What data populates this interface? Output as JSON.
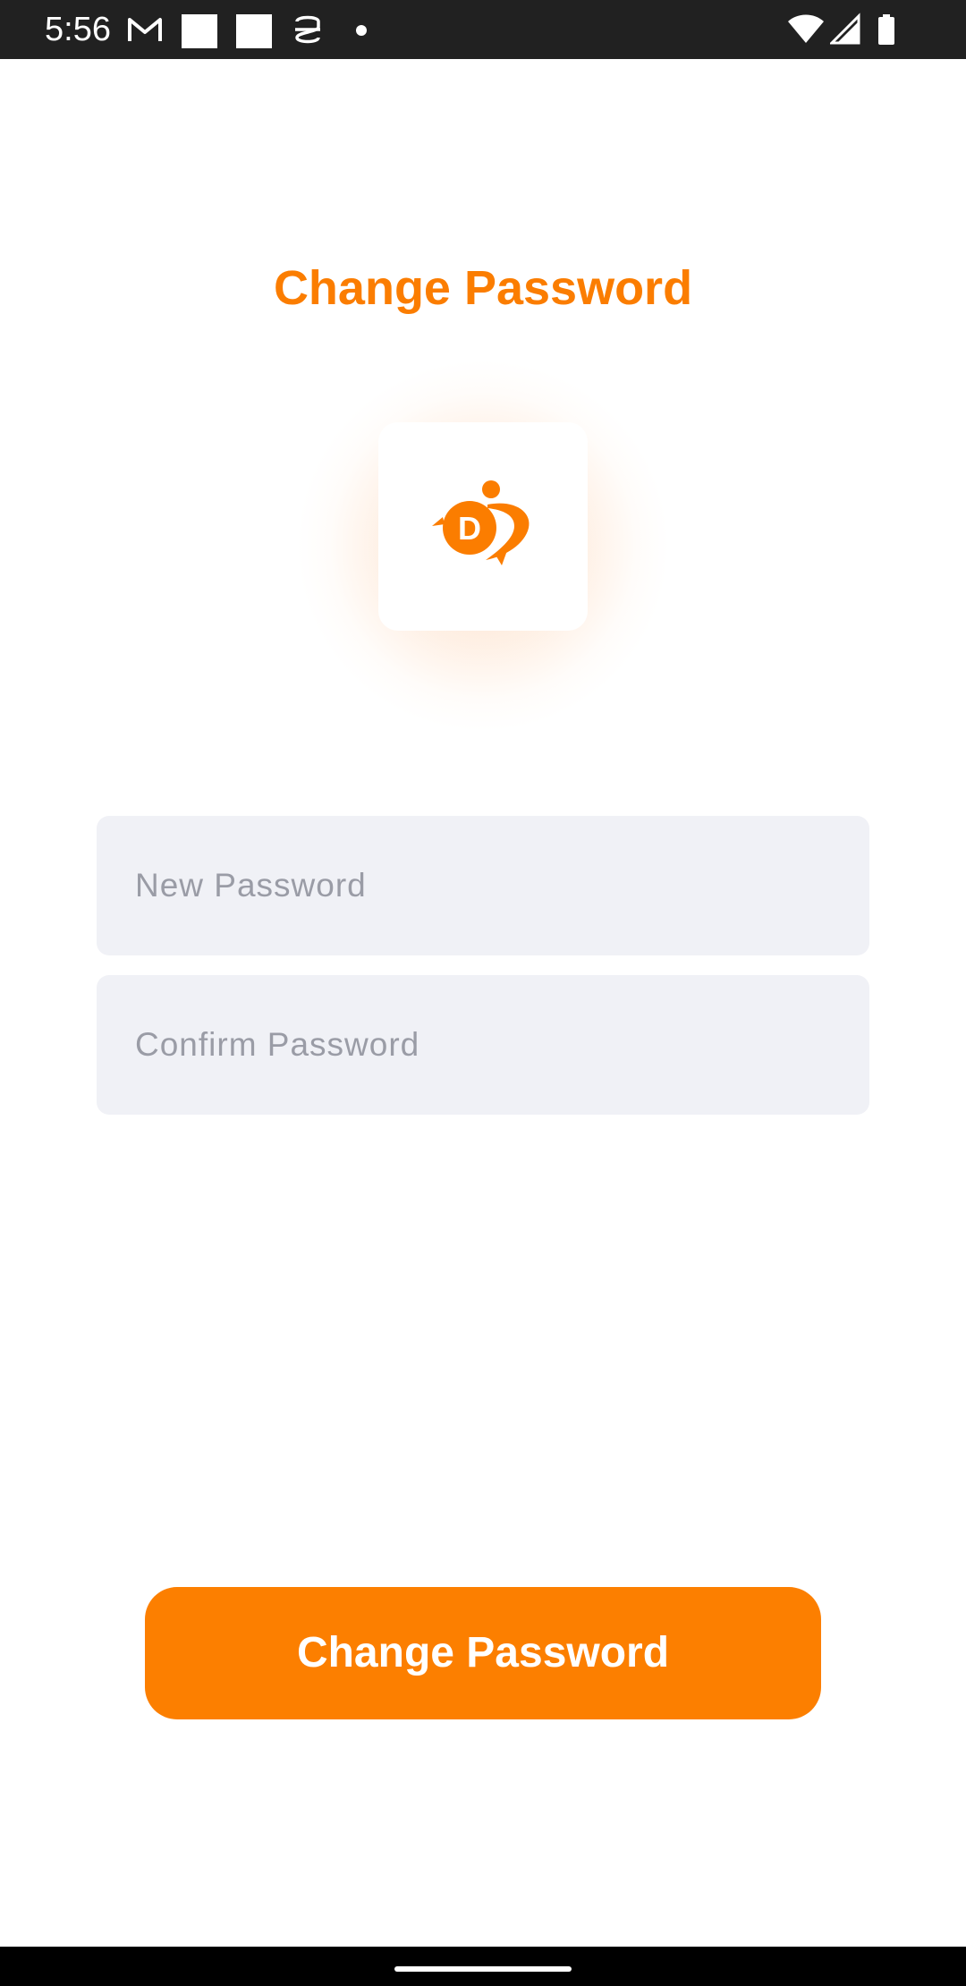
{
  "status_bar": {
    "time": "5:56",
    "icons": [
      "gmail-icon",
      "notification-square-icon",
      "notification-square-icon",
      "app-notification-icon",
      "dot-icon",
      "wifi-icon",
      "signal-icon",
      "battery-icon"
    ]
  },
  "header": {
    "title": "Change Password"
  },
  "logo": {
    "icon": "app-logo-icon",
    "letter": "D",
    "color": "#fb7d00"
  },
  "form": {
    "new_password": {
      "placeholder": "New Password",
      "value": ""
    },
    "confirm_password": {
      "placeholder": "Confirm Password",
      "value": ""
    },
    "submit_label": "Change Password"
  },
  "colors": {
    "accent": "#fb7d00",
    "input_background": "#f0f1f6",
    "placeholder": "#9a9ca6",
    "status_bar": "#212121"
  }
}
